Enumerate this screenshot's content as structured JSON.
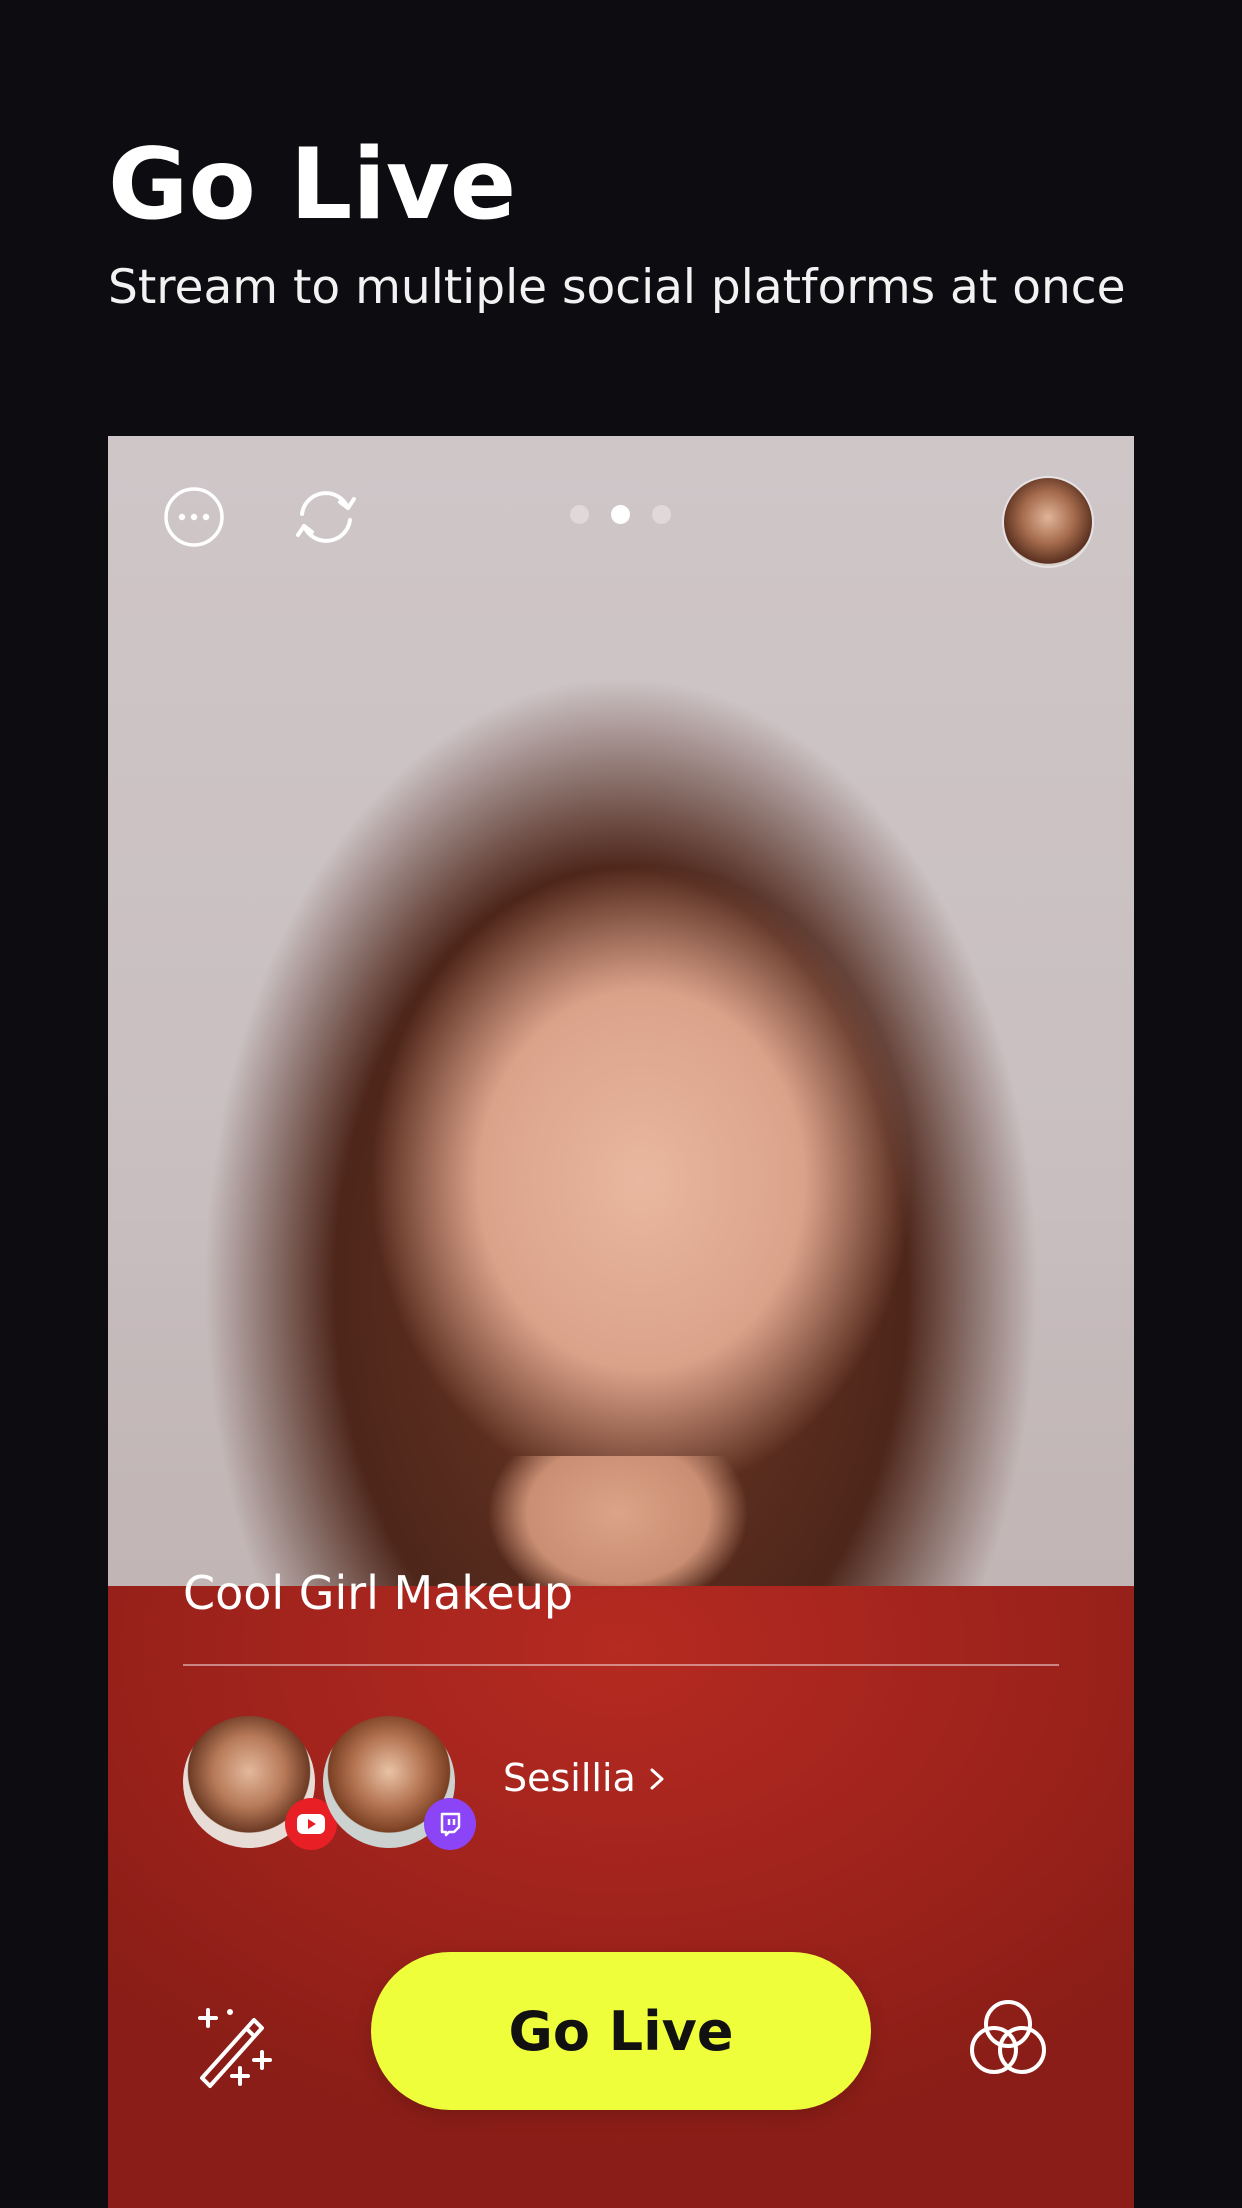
{
  "header": {
    "title": "Go Live",
    "subtitle": "Stream to multiple social platforms at once"
  },
  "camera": {
    "topbar": {
      "more_icon": "more-options-icon",
      "flip_icon": "flip-camera-icon",
      "page_indicator": {
        "count": 3,
        "active": 2
      },
      "profile_icon": "profile-avatar"
    },
    "stream_title": "Cool Girl Makeup",
    "guests": [
      {
        "platform": "youtube",
        "badge_color": "#e81f25"
      },
      {
        "platform": "twitch",
        "badge_color": "#8c44f7"
      }
    ],
    "host_name": "Sesillia",
    "go_live_label": "Go Live",
    "go_live_color": "#eefe3a",
    "effects_icon": "magic-wand-icon",
    "filters_icon": "filters-circles-icon"
  }
}
